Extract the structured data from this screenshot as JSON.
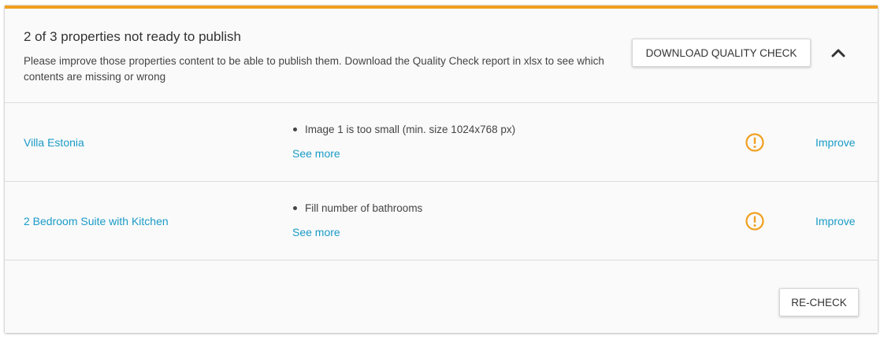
{
  "header": {
    "title": "2 of 3 properties not ready to publish",
    "description": "Please improve those properties content to be able to publish them. Download the Quality Check report in xlsx to see which contents are missing or wrong",
    "download_button": "DOWNLOAD QUALITY CHECK",
    "collapse_icon": "chevron-up-icon"
  },
  "properties": [
    {
      "name": "Villa Estonia",
      "issue": "Image 1 is too small (min. size 1024x768 px)",
      "see_more": "See more",
      "status_icon": "warning-icon",
      "action": "Improve"
    },
    {
      "name": "2 Bedroom Suite with Kitchen",
      "issue": "Fill number of bathrooms",
      "see_more": "See more",
      "status_icon": "warning-icon",
      "action": "Improve"
    }
  ],
  "footer": {
    "recheck_button": "RE-CHECK"
  },
  "colors": {
    "accent": "#f0a020",
    "link": "#1a9bc7",
    "warning": "#f0a020"
  }
}
